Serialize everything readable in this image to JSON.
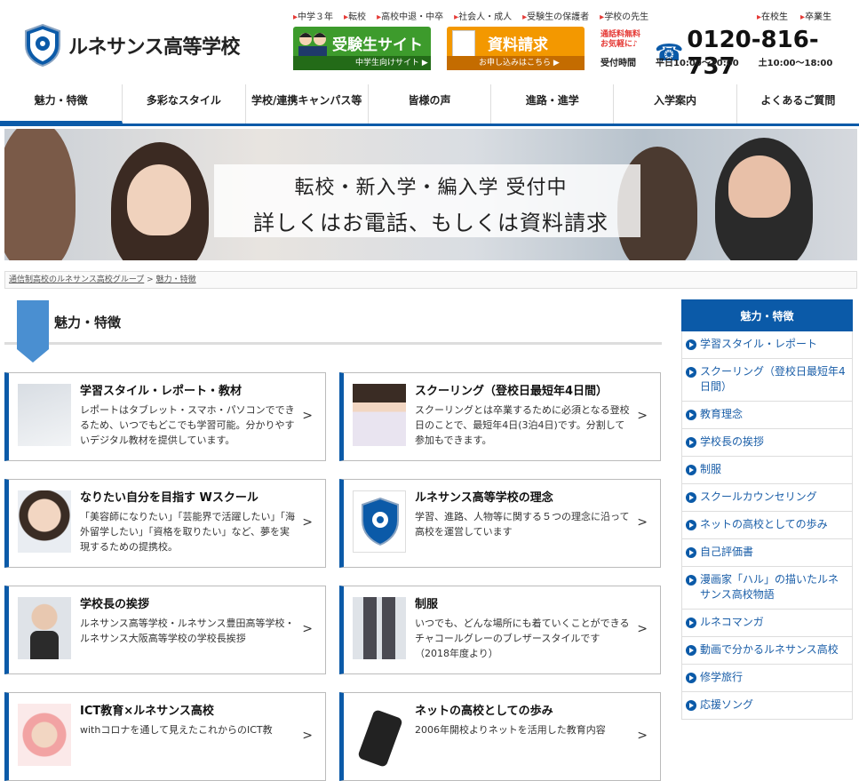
{
  "header": {
    "logo_text": "ルネサンス高等学校",
    "toplinks": [
      "中学３年",
      "転校",
      "高校中退・中卒",
      "社会人・成人",
      "受験生の保護者",
      "学校の先生"
    ],
    "toplinks2": [
      "在校生",
      "卒業生"
    ],
    "juken_title": "受験生サイト",
    "juken_sub": "中学生向けサイト ▶",
    "shiryo_title": "資料請求",
    "shiryo_sub": "お申し込みはこちら ▶",
    "freecall_line1": "通話料無料",
    "freecall_line2": "お気軽に♪",
    "tel": "0120-816-737",
    "hours_label": "受付時間",
    "hours_weekday": "平日10:00～20:00",
    "hours_weekend": "土10:00～18:00"
  },
  "nav": [
    "魅力・特徴",
    "多彩なスタイル",
    "学校/連携キャンパス等",
    "皆様の声",
    "進路・進学",
    "入学案内",
    "よくあるご質問"
  ],
  "hero": {
    "line1": "転校・新入学・編入学 受付中",
    "line2": "詳しくはお電話、もしくは資料請求"
  },
  "breadcrumb": {
    "home": "通信制高校のルネサンス高校グループ",
    "sep": ">",
    "current": "魅力・特徴"
  },
  "section_title": "魅力・特徴",
  "cards": [
    {
      "title": "学習スタイル・レポート・教材",
      "desc": "レポートはタブレット・スマホ・パソコンでできるため、いつでもどこでも学習可能。分かりやすいデジタル教材を提供しています。"
    },
    {
      "title": "スクーリング（登校日最短年4日間）",
      "desc": "スクーリングとは卒業するために必須となる登校日のことで、最短年4日(3泊4日)です。分割して参加もできます。"
    },
    {
      "title": "なりたい自分を目指す Wスクール",
      "desc": "「美容師になりたい」「芸能界で活躍したい」「海外留学したい」「資格を取りたい」など、夢を実現するための提携校。"
    },
    {
      "title": "ルネサンス高等学校の理念",
      "desc": "学習、進路、人物等に関する５つの理念に沿って高校を運営しています"
    },
    {
      "title": "学校長の挨拶",
      "desc": "ルネサンス高等学校・ルネサンス豊田高等学校・ルネサンス大阪高等学校の学校長挨拶"
    },
    {
      "title": "制服",
      "desc": "いつでも、どんな場所にも着ていくことができるチャコールグレーのブレザースタイルです（2018年度より）"
    },
    {
      "title": "ICT教育×ルネサンス高校",
      "desc": "withコロナを通して見えたこれからのICT教"
    },
    {
      "title": "ネットの高校としての歩み",
      "desc": "2006年開校よりネットを活用した教育内容"
    }
  ],
  "card_arrow": ">",
  "sidebar": {
    "head": "魅力・特徴",
    "items": [
      "学習スタイル・レポート",
      "スクーリング（登校日最短年4日間）",
      "教育理念",
      "学校長の挨拶",
      "制服",
      "スクールカウンセリング",
      "ネットの高校としての歩み",
      "自己評価書",
      "漫画家「ハル」の描いたルネサンス高校物語",
      "ルネコマンガ",
      "動画で分かるルネサンス高校",
      "修学旅行",
      "応援ソング"
    ]
  },
  "colors": {
    "brand": "#0b5aa8",
    "green": "#3d9b2c",
    "orange": "#f39800",
    "accent_red": "#e53935"
  }
}
